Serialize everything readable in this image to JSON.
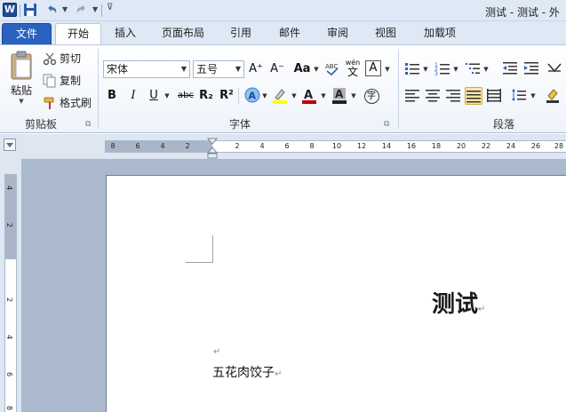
{
  "window": {
    "title": "测试 - 测试 - 外"
  },
  "tabs": [
    {
      "label": "文件"
    },
    {
      "label": "开始"
    },
    {
      "label": "插入"
    },
    {
      "label": "页面布局"
    },
    {
      "label": "引用"
    },
    {
      "label": "邮件"
    },
    {
      "label": "审阅"
    },
    {
      "label": "视图"
    },
    {
      "label": "加载项"
    }
  ],
  "ribbon": {
    "clipboard": {
      "paste": "粘贴",
      "cut": "剪切",
      "copy": "复制",
      "format_painter": "格式刷",
      "group_label": "剪贴板"
    },
    "font": {
      "font_name": "宋体",
      "font_size": "五号",
      "case_label": "Aa",
      "group_label": "字体",
      "bold": "B",
      "italic": "I",
      "underline": "U",
      "strikethrough": "abc",
      "subscript": "R₂",
      "superscript": "R²",
      "grow": "A⁺",
      "shrink": "A⁻",
      "enclose_char": "字",
      "phonetic_top": "wén",
      "phonetic_bottom": "文"
    },
    "paragraph": {
      "group_label": "段落"
    }
  },
  "ruler": {
    "horizontal_numbers": [
      "8",
      "6",
      "4",
      "2",
      "2",
      "4",
      "6",
      "8",
      "10",
      "12",
      "14",
      "16",
      "18",
      "20",
      "22",
      "24",
      "26",
      "28"
    ],
    "vertical_numbers": [
      "4",
      "2",
      "2",
      "4",
      "6",
      "8"
    ]
  },
  "document": {
    "title": "测试",
    "paragraph_mark": "↵",
    "body_text": "五花肉饺子"
  },
  "colors": {
    "file_tab": "#2a62c0",
    "highlight": "#ffff00",
    "font_color": "#c00000"
  }
}
